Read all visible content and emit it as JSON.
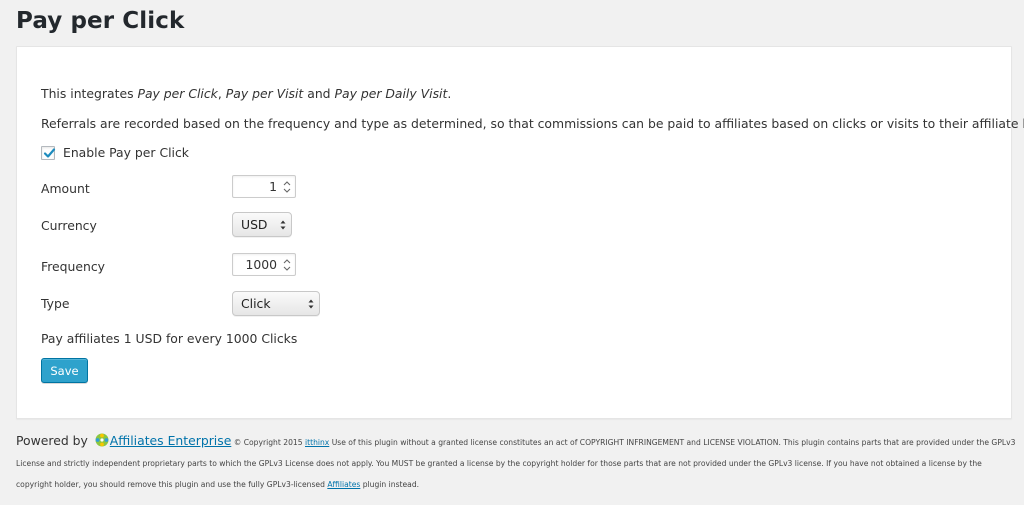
{
  "page": {
    "title": "Pay per Click"
  },
  "intro": {
    "lead": "This integrates ",
    "term1": "Pay per Click",
    "sep1": ", ",
    "term2": "Pay per Visit",
    "sep2": " and ",
    "term3": "Pay per Daily Visit",
    "end": ".",
    "description": "Referrals are recorded based on the frequency and type as determined, so that commissions can be paid to affiliates based on clicks or visits to their affiliate links."
  },
  "enable": {
    "label": "Enable Pay per Click",
    "checked": true
  },
  "form": {
    "amount_label": "Amount",
    "amount_value": "1",
    "currency_label": "Currency",
    "currency_value": "USD",
    "frequency_label": "Frequency",
    "frequency_value": "1000",
    "type_label": "Type",
    "type_value": "Click"
  },
  "summary": "Pay affiliates 1 USD for every 1000 Clicks",
  "save_label": "Save",
  "footer": {
    "powered_by": "Powered by ",
    "brand": "Affiliates Enterprise",
    "copyright": " © Copyright 2015 ",
    "company": "itthinx",
    "license_text": " Use of this plugin without a granted license constitutes an act of COPYRIGHT INFRINGEMENT and LICENSE VIOLATION. This plugin contains parts that are provided under the GPLv3 License and strictly independent proprietary parts to which the GPLv3 License does not apply. You MUST be granted a license by the copyright holder for those parts that are not provided under the GPLv3 license. If you have not obtained a license by the copyright holder, you should remove this plugin and use the fully GPLv3-licensed ",
    "affiliates_link": "Affiliates",
    "closing": " plugin instead."
  },
  "colors": {
    "accent": "#2ea2cc",
    "link": "#0073aa",
    "background": "#f1f1f1"
  }
}
